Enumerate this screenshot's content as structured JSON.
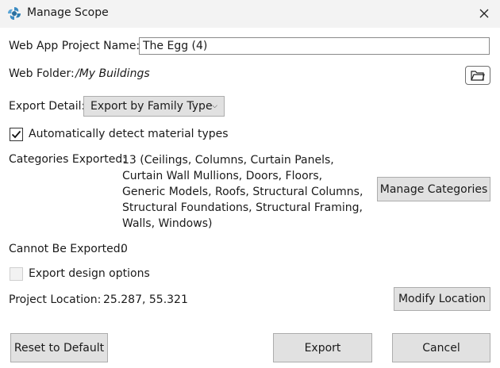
{
  "window": {
    "title": "Manage Scope",
    "app_icon": "fan-logo-icon",
    "close_icon": "close-icon"
  },
  "project_name": {
    "label": "Web App Project Name:",
    "value": "The Egg (4)"
  },
  "web_folder": {
    "label": "Web Folder:",
    "value": "/My Buildings",
    "browse_icon": "folder-icon"
  },
  "export_detail": {
    "label": "Export Detail:",
    "selected": "Export by Family Type"
  },
  "auto_detect": {
    "label": "Automatically detect material types",
    "checked": true
  },
  "categories": {
    "label": "Categories Exported:",
    "value": "13 (Ceilings, Columns, Curtain Panels, Curtain Wall Mullions, Doors, Floors, Generic Models, Roofs, Structural Columns, Structural Foundations, Structural Framing, Walls, Windows)",
    "manage_button": "Manage Categories"
  },
  "cannot_export": {
    "label": "Cannot Be Exported:",
    "value": "0"
  },
  "design_options": {
    "label": "Export design options",
    "checked": false
  },
  "location": {
    "label": "Project Location:",
    "value": "25.287, 55.321",
    "modify_button": "Modify Location"
  },
  "footer": {
    "reset_button": "Reset to Default",
    "export_button": "Export",
    "cancel_button": "Cancel"
  }
}
